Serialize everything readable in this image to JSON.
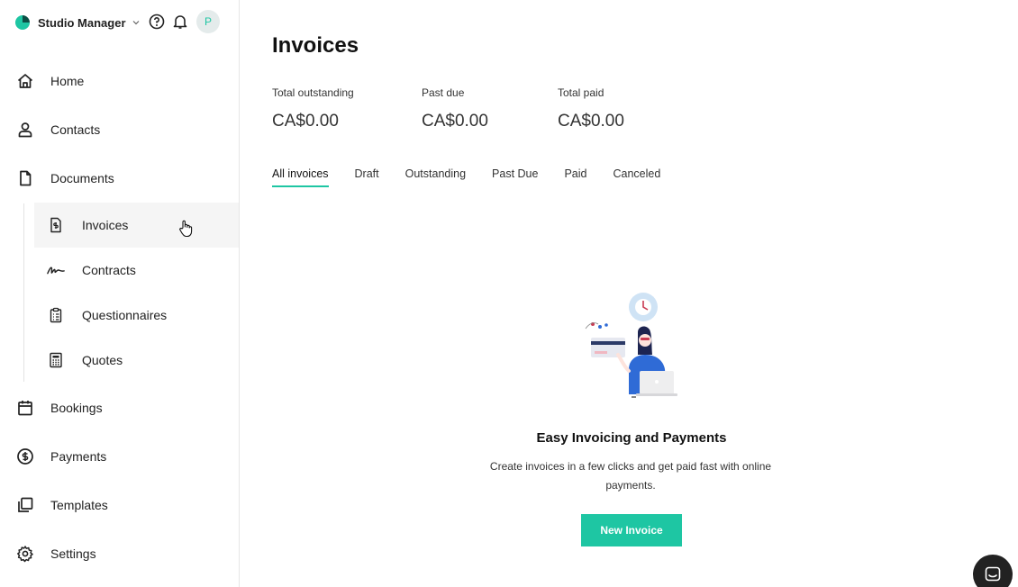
{
  "brand": {
    "name": "Studio Manager",
    "avatar_initial": "P"
  },
  "nav": {
    "home": "Home",
    "contacts": "Contacts",
    "documents": "Documents",
    "sub": {
      "invoices": "Invoices",
      "contracts": "Contracts",
      "questionnaires": "Questionnaires",
      "quotes": "Quotes"
    },
    "bookings": "Bookings",
    "payments": "Payments",
    "templates": "Templates",
    "settings": "Settings"
  },
  "page": {
    "title": "Invoices",
    "stats": [
      {
        "label": "Total outstanding",
        "value": "CA$0.00"
      },
      {
        "label": "Past due",
        "value": "CA$0.00"
      },
      {
        "label": "Total paid",
        "value": "CA$0.00"
      }
    ],
    "tabs": [
      "All invoices",
      "Draft",
      "Outstanding",
      "Past Due",
      "Paid",
      "Canceled"
    ],
    "active_tab": "All invoices",
    "empty": {
      "title": "Easy Invoicing and Payments",
      "description": "Create invoices in a few clicks and get paid fast with online payments.",
      "button": "New Invoice"
    }
  },
  "colors": {
    "accent": "#1ec6a3",
    "chat": "#222222"
  },
  "icons": [
    "logo-icon",
    "chevron-down-icon",
    "help-icon",
    "bell-icon",
    "home-icon",
    "user-icon",
    "document-icon",
    "invoice-icon",
    "signature-icon",
    "clipboard-icon",
    "calculator-icon",
    "calendar-icon",
    "dollar-icon",
    "templates-icon",
    "gear-icon",
    "chat-icon"
  ]
}
